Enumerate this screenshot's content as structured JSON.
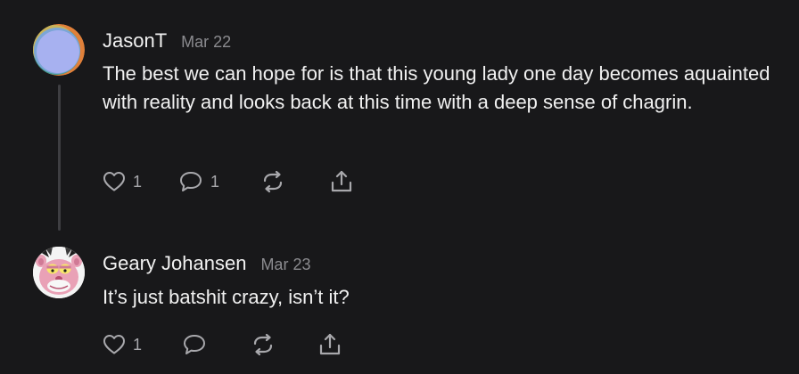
{
  "comments": [
    {
      "author": "JasonT",
      "date": "Mar 22",
      "text": "The best we can hope for is that this young lady one day becomes aquainted with reality and looks back at this time with a deep sense of chagrin.",
      "likes": "1",
      "replies": "1"
    },
    {
      "author": "Geary Johansen",
      "date": "Mar 23",
      "text": "It’s just batshit crazy, isn’t it?",
      "likes": "1",
      "replies": ""
    }
  ],
  "icons": {
    "like": "heart-icon",
    "reply": "speech-bubble-icon",
    "restack": "restack-icon",
    "share": "share-icon"
  },
  "colors": {
    "background": "#18181a",
    "text": "#f1f1f1",
    "muted": "#8b8b8f",
    "icon": "#a8a8ac",
    "thread_line": "#3e3e42"
  }
}
